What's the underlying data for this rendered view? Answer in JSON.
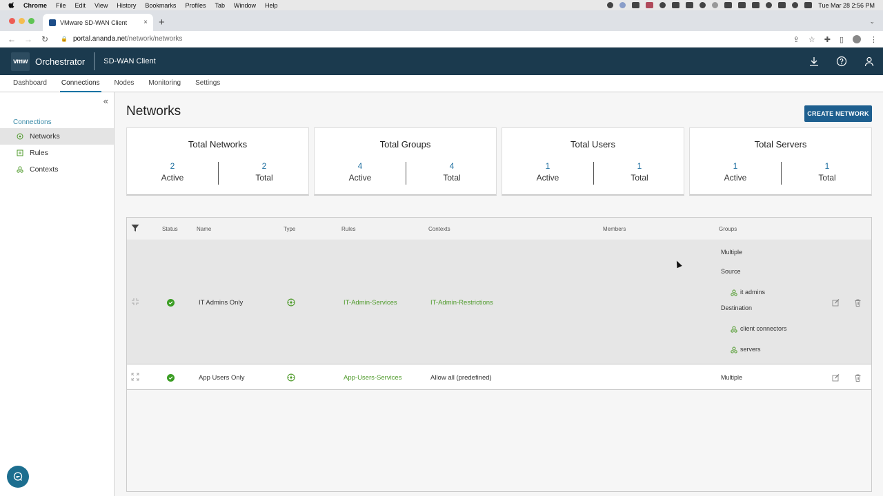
{
  "os_menubar": {
    "app": "Chrome",
    "menus": [
      "File",
      "Edit",
      "View",
      "History",
      "Bookmarks",
      "Profiles",
      "Tab",
      "Window",
      "Help"
    ],
    "clock": "Tue Mar 28  2:56 PM"
  },
  "browser": {
    "tab_title": "VMware SD-WAN Client",
    "tab_close": "×",
    "new_tab": "+",
    "url_host": "portal.ananda.net",
    "url_path": "/network/networks"
  },
  "header": {
    "logo": "vmw",
    "app_name": "Orchestrator",
    "sub_title": "SD-WAN Client"
  },
  "nav": {
    "tabs": [
      "Dashboard",
      "Connections",
      "Nodes",
      "Monitoring",
      "Settings"
    ],
    "active": "Connections"
  },
  "sidebar": {
    "section": "Connections",
    "items": [
      {
        "label": "Networks",
        "icon": "network-icon",
        "active": true
      },
      {
        "label": "Rules",
        "icon": "rules-icon",
        "active": false
      },
      {
        "label": "Contexts",
        "icon": "contexts-icon",
        "active": false
      }
    ],
    "collapse": "«"
  },
  "page": {
    "title": "Networks",
    "create_button": "CREATE NETWORK"
  },
  "stats": [
    {
      "title": "Total Networks",
      "active": "2",
      "active_label": "Active",
      "total": "2",
      "total_label": "Total"
    },
    {
      "title": "Total Groups",
      "active": "4",
      "active_label": "Active",
      "total": "4",
      "total_label": "Total"
    },
    {
      "title": "Total Users",
      "active": "1",
      "active_label": "Active",
      "total": "1",
      "total_label": "Total"
    },
    {
      "title": "Total Servers",
      "active": "1",
      "active_label": "Active",
      "total": "1",
      "total_label": "Total"
    }
  ],
  "table": {
    "headers": {
      "status": "Status",
      "name": "Name",
      "type": "Type",
      "rules": "Rules",
      "contexts": "Contexts",
      "members": "Members",
      "groups": "Groups"
    },
    "rows": [
      {
        "name": "IT Admins Only",
        "rules": "IT-Admin-Services",
        "contexts": "IT-Admin-Restrictions",
        "groups_summary": "Multiple",
        "source_label": "Source",
        "source_groups": [
          "it admins"
        ],
        "destination_label": "Destination",
        "destination_groups": [
          "client connectors",
          "servers"
        ]
      },
      {
        "name": "App Users Only",
        "rules": "App-Users-Services",
        "contexts": "Allow all (predefined)",
        "groups_summary": "Multiple"
      }
    ]
  },
  "colors": {
    "header_bg": "#1b3a4e",
    "accent_blue": "#1e5f8f",
    "link_green": "#4e9a2a",
    "status_green": "#3a9d23"
  }
}
